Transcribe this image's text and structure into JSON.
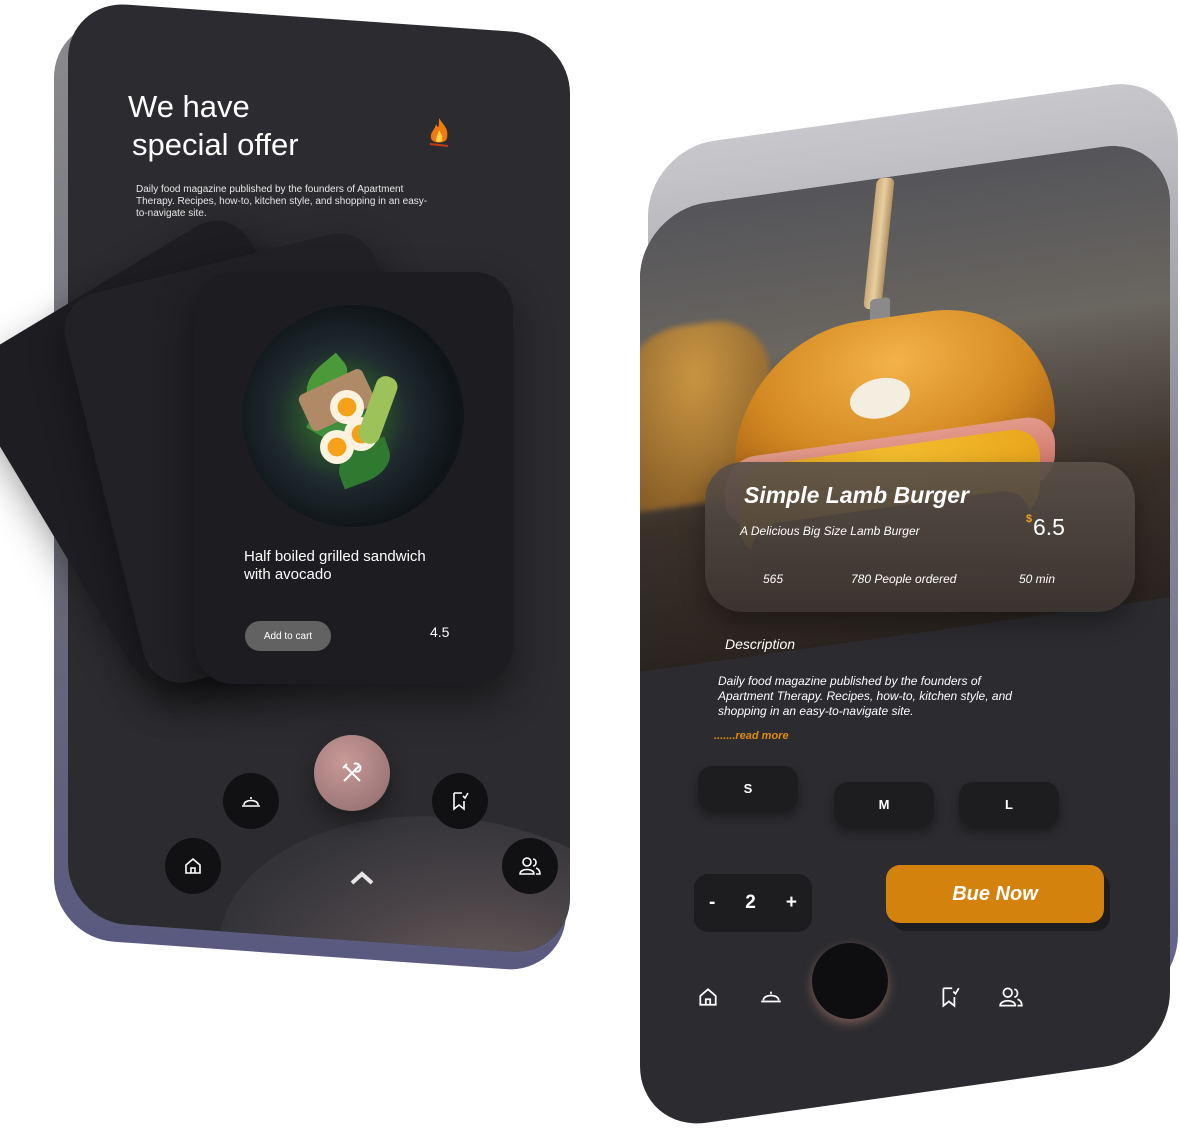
{
  "left_screen": {
    "title_line1": "We have",
    "title_line2": "special offer",
    "description": "Daily food magazine published by the founders of Apartment Therapy. Recipes, how-to, kitchen style, and shopping in an easy-to-navigate site.",
    "flame_icon": "flame-icon",
    "card": {
      "title": "Half boiled grilled sandwich with avocado",
      "add_to_cart": "Add to cart",
      "rating": "4.5"
    },
    "nav_icons": [
      "home-icon",
      "cloche-icon",
      "fork-spoon-icon",
      "bookmark-check-icon",
      "users-icon",
      "chevron-up-icon"
    ]
  },
  "right_screen": {
    "product_name": "Simple Lamb Burger",
    "subtitle": "A Delicious Big Size Lamb Burger",
    "currency": "$",
    "price": "6.5",
    "stat_count": "565",
    "people_ordered": "780 People ordered",
    "time": "50 min",
    "description_heading": "Description",
    "description": "Daily food magazine published by the founders of Apartment Therapy. Recipes, how-to, kitchen style, and shopping in an easy-to-navigate site.",
    "read_more": ".......read more",
    "sizes": [
      "S",
      "M",
      "L"
    ],
    "qty_minus": "-",
    "qty_value": "2",
    "qty_plus": "+",
    "buy_label": "Bue  Now",
    "accent_color": "#d4820e",
    "nav_icons": [
      "home-icon",
      "cloche-icon",
      "bookmark-check-icon",
      "users-icon"
    ]
  }
}
